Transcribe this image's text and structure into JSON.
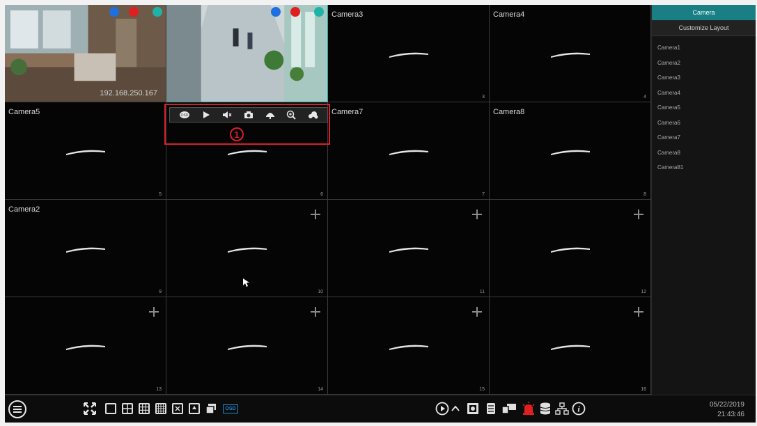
{
  "tiles": [
    {
      "name": "",
      "number": "",
      "ip": "192.168.250.167"
    },
    {
      "name": "",
      "number": ""
    },
    {
      "name": "Camera3",
      "number": "3"
    },
    {
      "name": "Camera4",
      "number": "4"
    },
    {
      "name": "Camera5",
      "number": "5"
    },
    {
      "name": "",
      "number": "6"
    },
    {
      "name": "Camera7",
      "number": "7"
    },
    {
      "name": "Camera8",
      "number": "8"
    },
    {
      "name": "Camera2",
      "number": "9"
    },
    {
      "name": "",
      "number": "10"
    },
    {
      "name": "",
      "number": "11"
    },
    {
      "name": "",
      "number": "12"
    },
    {
      "name": "",
      "number": "13"
    },
    {
      "name": "",
      "number": "14"
    },
    {
      "name": "",
      "number": "15"
    },
    {
      "name": "",
      "number": "16"
    }
  ],
  "ptz_toolbar": {
    "callout_number": "1",
    "buttons": [
      "osd-icon",
      "play-icon",
      "mute-icon",
      "snapshot-icon",
      "ptz-icon",
      "zoom-in-icon",
      "color-settings-icon"
    ]
  },
  "sidebar": {
    "tab_camera": "Camera",
    "tab_layout": "Customize Layout",
    "cameras": [
      "Camera1",
      "Camera2",
      "Camera3",
      "Camera4",
      "Camera5",
      "Camera6",
      "Camera7",
      "Camera8",
      "Camera81"
    ]
  },
  "taskbar": {
    "osd_label": "OSD",
    "date": "05/22/2019",
    "time": "21:43:46"
  },
  "colors": {
    "accent": "#1a7e85",
    "callout": "#d71f2b",
    "selected_border": "#2aa7a7"
  }
}
